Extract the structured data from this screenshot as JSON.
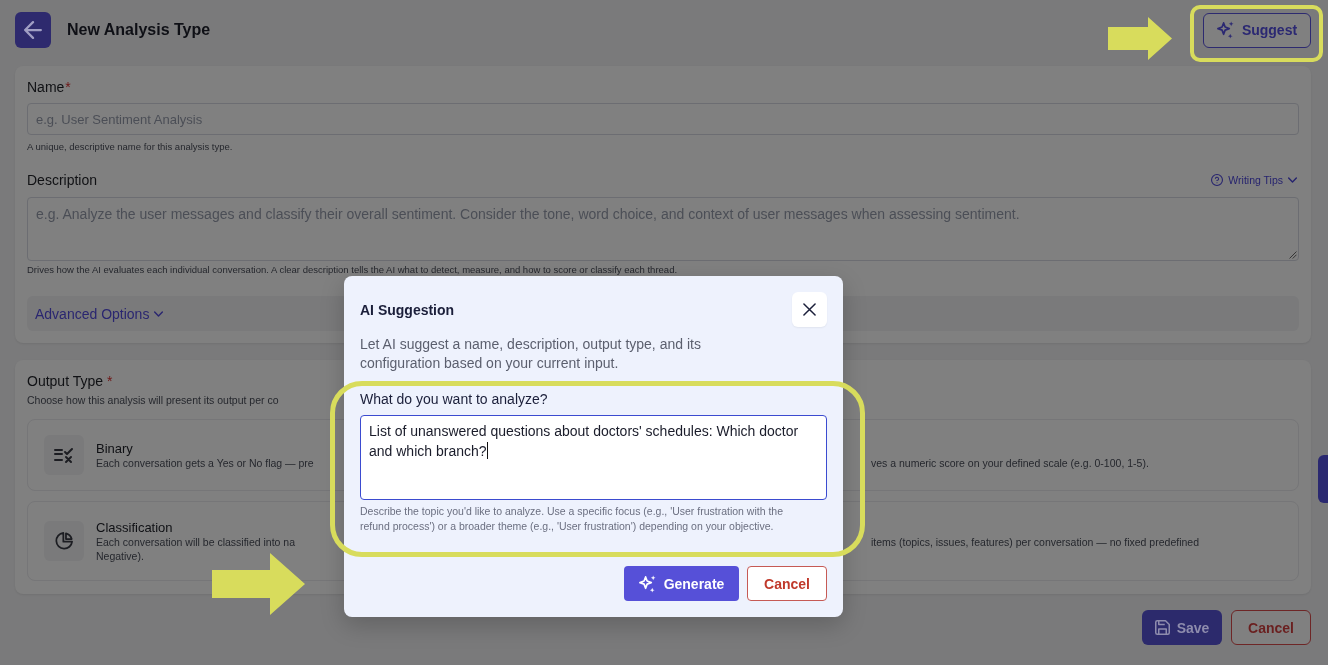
{
  "header": {
    "title": "New Analysis Type",
    "suggest_label": "Suggest"
  },
  "details": {
    "name": {
      "label": "Name",
      "required_mark": "*",
      "placeholder": "e.g. User Sentiment Analysis",
      "help": "A unique, descriptive name for this analysis type."
    },
    "description": {
      "label": "Description",
      "writing_tips": {
        "label": "Writing Tips",
        "expanded": false
      },
      "placeholder": "e.g. Analyze the user messages and classify their overall sentiment. Consider the tone, word choice, and context of user messages when assessing sentiment.",
      "help": "Drives how the AI evaluates each individual conversation. A clear description tells the AI what to detect, measure, and how to score or classify each thread."
    },
    "advanced_options": {
      "label": "Advanced Options",
      "expanded": false
    }
  },
  "output_type": {
    "label": "Output Type",
    "required_mark": "*",
    "help": "Choose how this analysis will present its output per co",
    "options": [
      {
        "kind": "binary",
        "selected": false,
        "title": "Binary",
        "description_lines": [
          "Each conversation gets a Yes or No flag — pre"
        ]
      },
      {
        "kind": "covered",
        "selected": false,
        "description_lines": [
          "ves a numeric score on your defined scale (e.g. 0-100, 1-5)."
        ]
      },
      {
        "kind": "classification",
        "selected": false,
        "title": "Classification",
        "description_lines": [
          "Each conversation will be classified into na",
          "Negative)."
        ]
      },
      {
        "kind": "covered",
        "selected": false,
        "description_lines": [
          "items (topics, issues, features) per conversation — no fixed predefined"
        ]
      }
    ]
  },
  "footer": {
    "buttons": [
      {
        "kind": "primary",
        "label": "Save"
      },
      {
        "kind": "secondary",
        "label": "Cancel"
      }
    ]
  },
  "dialog": {
    "title": "AI Suggestion",
    "description": "Let AI suggest a name, description, output type, and its configuration based on your current input.",
    "field": {
      "label": "What do you want to analyze?",
      "value": "List of unanswered questions about doctors' schedules: Which doctor and which branch?",
      "focused": true,
      "help": "Describe the topic you'd like to analyze. Use a specific focus (e.g., 'User frustration with the refund process') or a broader theme (e.g., 'User frustration') depending on your objective."
    },
    "buttons": [
      {
        "kind": "primary",
        "label": "Generate"
      },
      {
        "kind": "secondary",
        "label": "Cancel"
      }
    ]
  }
}
